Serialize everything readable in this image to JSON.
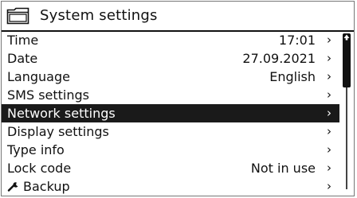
{
  "header": {
    "title": "System settings",
    "icon": "folder-icon"
  },
  "menu": {
    "items": [
      {
        "label": "Time",
        "value": "17:01",
        "chevron": "›"
      },
      {
        "label": "Date",
        "value": "27.09.2021",
        "chevron": "›"
      },
      {
        "label": "Language",
        "value": "English",
        "chevron": "›"
      },
      {
        "label": "SMS settings",
        "value": "",
        "chevron": "›"
      },
      {
        "label": "Network settings",
        "value": "",
        "chevron": "›",
        "selected": true
      },
      {
        "label": "Display settings",
        "value": "",
        "chevron": "›"
      },
      {
        "label": "Type info",
        "value": "",
        "chevron": "›"
      },
      {
        "label": "Lock code",
        "value": "Not in use",
        "chevron": "›"
      },
      {
        "label": "Backup",
        "value": "",
        "chevron": "›",
        "icon": "wrench-icon"
      }
    ]
  },
  "scrollbar": {
    "position": 0.0,
    "visible_fraction": 0.35
  },
  "colors": {
    "selected_bg": "#1a1a1a",
    "selected_fg": "#ffffff",
    "text": "#111111"
  }
}
